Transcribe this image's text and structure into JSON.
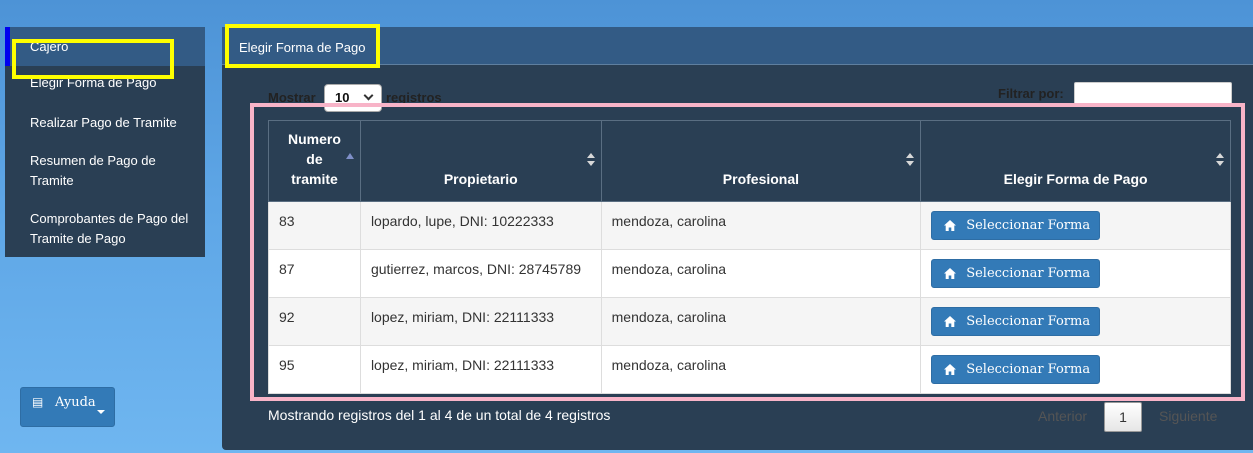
{
  "sidebar": {
    "header": "Cajero",
    "items": [
      {
        "label": "Elegir Forma de Pago"
      },
      {
        "label": "Realizar Pago de Tramite"
      },
      {
        "label": "Resumen de Pago de Tramite"
      },
      {
        "label": "Comprobantes de Pago del Tramite de Pago"
      }
    ]
  },
  "help": {
    "label": "Ayuda"
  },
  "panel": {
    "title": "Elegir Forma de Pago"
  },
  "length": {
    "prefix": "Mostrar",
    "value": "10",
    "suffix": "registros"
  },
  "filter": {
    "label": "Filtrar por:",
    "value": ""
  },
  "table": {
    "headers": [
      "Numero de tramite",
      "Propietario",
      "Profesional",
      "Elegir Forma de Pago"
    ],
    "rows": [
      {
        "numero": "83",
        "propietario": "lopardo, lupe, DNI: 10222333",
        "profesional": "mendoza, carolina",
        "action": "Seleccionar Forma"
      },
      {
        "numero": "87",
        "propietario": "gutierrez, marcos, DNI: 28745789",
        "profesional": "mendoza, carolina",
        "action": "Seleccionar Forma"
      },
      {
        "numero": "92",
        "propietario": "lopez, miriam, DNI: 22111333",
        "profesional": "mendoza, carolina",
        "action": "Seleccionar Forma"
      },
      {
        "numero": "95",
        "propietario": "lopez, miriam, DNI: 22111333",
        "profesional": "mendoza, carolina",
        "action": "Seleccionar Forma"
      }
    ]
  },
  "footer": {
    "info": "Mostrando registros del 1 al 4 de un total de 4 registros",
    "prev": "Anterior",
    "current_page": "1",
    "next": "Siguiente"
  },
  "colors": {
    "panel_bg": "#2a3f54",
    "header_bg": "#335b85",
    "button_blue": "#337ab7",
    "highlight_yellow": "#ffff00",
    "highlight_pink": "#f8b4c8"
  }
}
